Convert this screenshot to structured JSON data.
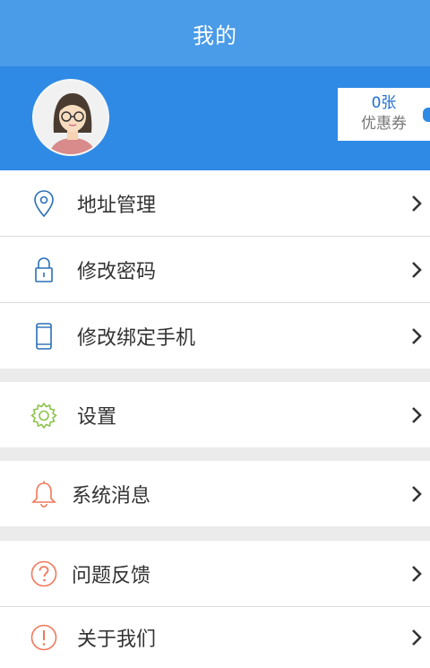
{
  "header": {
    "title": "我的"
  },
  "profile": {
    "username": "",
    "coupon_count": "0张",
    "coupon_label": "优惠券"
  },
  "menu": {
    "address": "地址管理",
    "password": "修改密码",
    "phone": "修改绑定手机",
    "settings": "设置",
    "messages": "系统消息",
    "feedback": "问题反馈",
    "about": "关于我们"
  },
  "colors": {
    "header_bg": "#4a9be8",
    "profile_bg": "#2f8ae6",
    "icon_blue": "#2a6fb6",
    "icon_green": "#8bc34a",
    "icon_orange": "#f0785a"
  },
  "icons": {
    "address": "location-pin-icon",
    "password": "lock-icon",
    "phone": "mobile-phone-icon",
    "settings": "gear-icon",
    "messages": "bell-icon",
    "feedback": "question-circle-icon",
    "about": "exclamation-circle-icon",
    "chevron": "chevron-right-icon"
  }
}
